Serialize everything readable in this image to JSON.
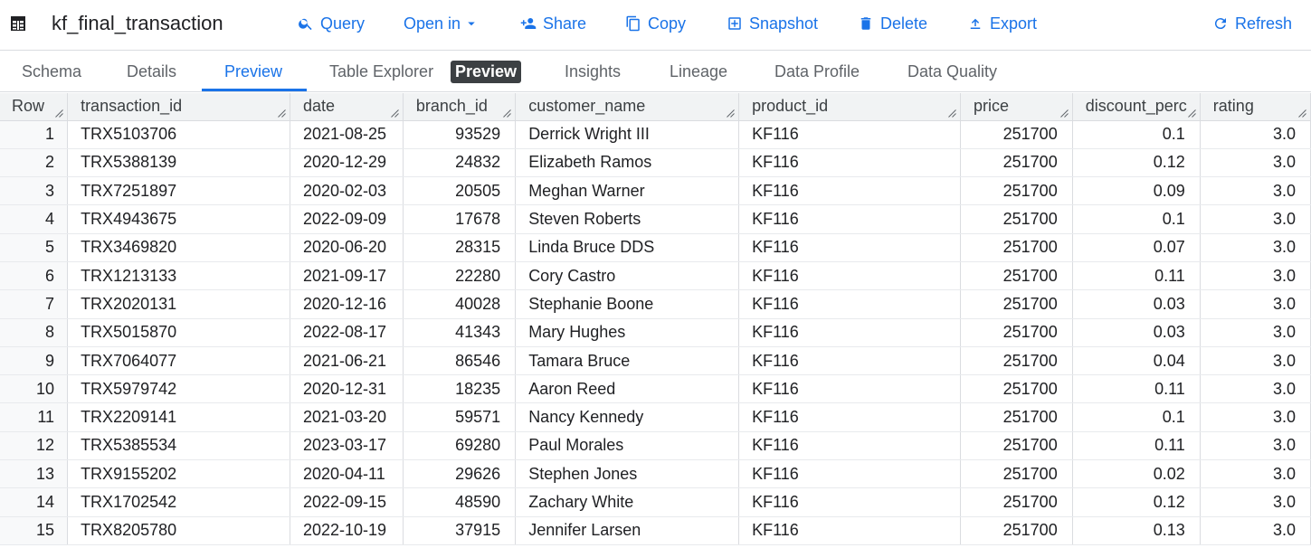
{
  "header": {
    "title": "kf_final_transaction",
    "actions": {
      "query": "Query",
      "open_in": "Open in",
      "share": "Share",
      "copy": "Copy",
      "snapshot": "Snapshot",
      "delete": "Delete",
      "export": "Export",
      "refresh": "Refresh"
    },
    "icons": [
      "table-icon",
      "search-icon",
      "chevron-down-icon",
      "person-add-icon",
      "copy-icon",
      "snapshot-icon",
      "trash-icon",
      "upload-icon",
      "refresh-icon"
    ],
    "accent_color": "#1a73e8"
  },
  "tabs": {
    "schema": "Schema",
    "details": "Details",
    "preview": "Preview",
    "table_explorer": "Table Explorer",
    "table_explorer_badge": "Preview",
    "insights": "Insights",
    "lineage": "Lineage",
    "data_profile": "Data Profile",
    "data_quality": "Data Quality",
    "active": "Preview"
  },
  "grid": {
    "columns": [
      "Row",
      "transaction_id",
      "date",
      "branch_id",
      "customer_name",
      "product_id",
      "price",
      "discount_perc",
      "rating"
    ],
    "rows": [
      [
        "1",
        "TRX5103706",
        "2021-08-25",
        "93529",
        "Derrick Wright III",
        "KF116",
        "251700",
        "0.1",
        "3.0"
      ],
      [
        "2",
        "TRX5388139",
        "2020-12-29",
        "24832",
        "Elizabeth Ramos",
        "KF116",
        "251700",
        "0.12",
        "3.0"
      ],
      [
        "3",
        "TRX7251897",
        "2020-02-03",
        "20505",
        "Meghan Warner",
        "KF116",
        "251700",
        "0.09",
        "3.0"
      ],
      [
        "4",
        "TRX4943675",
        "2022-09-09",
        "17678",
        "Steven Roberts",
        "KF116",
        "251700",
        "0.1",
        "3.0"
      ],
      [
        "5",
        "TRX3469820",
        "2020-06-20",
        "28315",
        "Linda Bruce DDS",
        "KF116",
        "251700",
        "0.07",
        "3.0"
      ],
      [
        "6",
        "TRX1213133",
        "2021-09-17",
        "22280",
        "Cory Castro",
        "KF116",
        "251700",
        "0.11",
        "3.0"
      ],
      [
        "7",
        "TRX2020131",
        "2020-12-16",
        "40028",
        "Stephanie Boone",
        "KF116",
        "251700",
        "0.03",
        "3.0"
      ],
      [
        "8",
        "TRX5015870",
        "2022-08-17",
        "41343",
        "Mary Hughes",
        "KF116",
        "251700",
        "0.03",
        "3.0"
      ],
      [
        "9",
        "TRX7064077",
        "2021-06-21",
        "86546",
        "Tamara Bruce",
        "KF116",
        "251700",
        "0.04",
        "3.0"
      ],
      [
        "10",
        "TRX5979742",
        "2020-12-31",
        "18235",
        "Aaron Reed",
        "KF116",
        "251700",
        "0.11",
        "3.0"
      ],
      [
        "11",
        "TRX2209141",
        "2021-03-20",
        "59571",
        "Nancy Kennedy",
        "KF116",
        "251700",
        "0.1",
        "3.0"
      ],
      [
        "12",
        "TRX5385534",
        "2023-03-17",
        "69280",
        "Paul Morales",
        "KF116",
        "251700",
        "0.11",
        "3.0"
      ],
      [
        "13",
        "TRX9155202",
        "2020-04-11",
        "29626",
        "Stephen Jones",
        "KF116",
        "251700",
        "0.02",
        "3.0"
      ],
      [
        "14",
        "TRX1702542",
        "2022-09-15",
        "48590",
        "Zachary White",
        "KF116",
        "251700",
        "0.12",
        "3.0"
      ],
      [
        "15",
        "TRX8205780",
        "2022-10-19",
        "37915",
        "Jennifer Larsen",
        "KF116",
        "251700",
        "0.13",
        "3.0"
      ]
    ]
  }
}
